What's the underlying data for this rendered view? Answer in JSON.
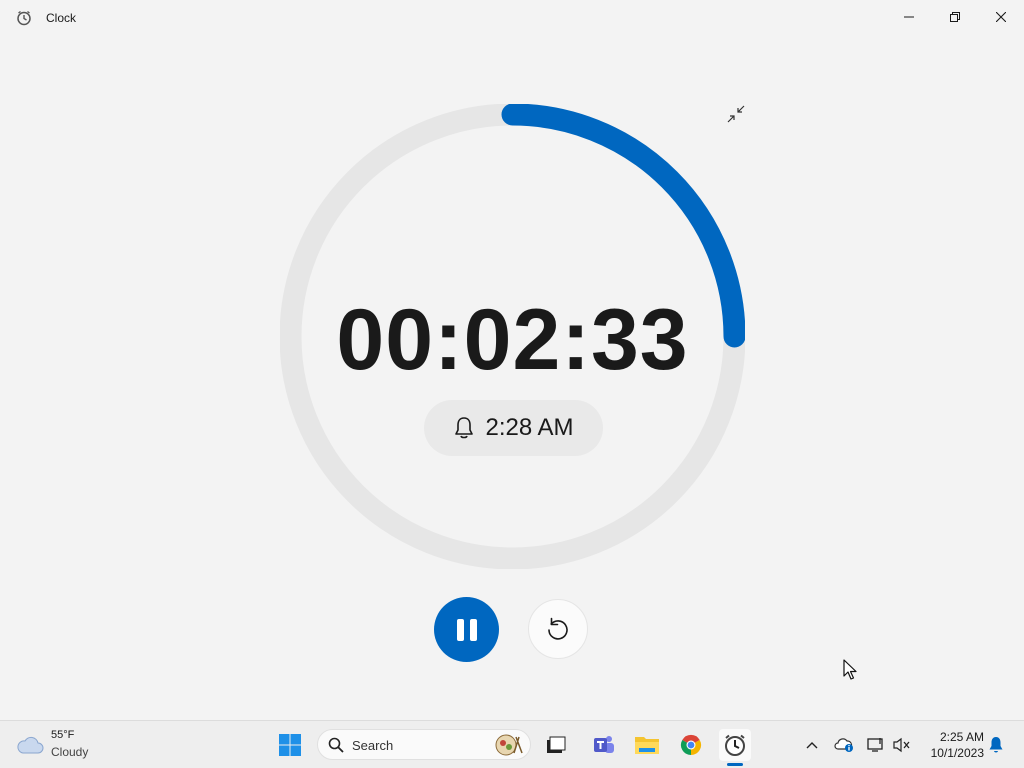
{
  "window": {
    "title": "Clock"
  },
  "timer": {
    "remaining": "00:02:33",
    "ends_at": "2:28 AM",
    "progress_remaining": 0.25
  },
  "colors": {
    "accent": "#0067c0",
    "track": "#e6e6e6"
  },
  "icons": {
    "app": "clock-app-icon",
    "minimize": "minimize-icon",
    "maximize": "restore-icon",
    "close": "close-icon",
    "compact": "compact-overlay-icon",
    "bell": "bell-icon",
    "pause": "pause-icon",
    "reset": "reset-icon"
  },
  "taskbar": {
    "weather": {
      "temp": "55°F",
      "condition": "Cloudy"
    },
    "search_label": "Search",
    "clock": {
      "time": "2:25 AM",
      "date": "10/1/2023"
    }
  }
}
